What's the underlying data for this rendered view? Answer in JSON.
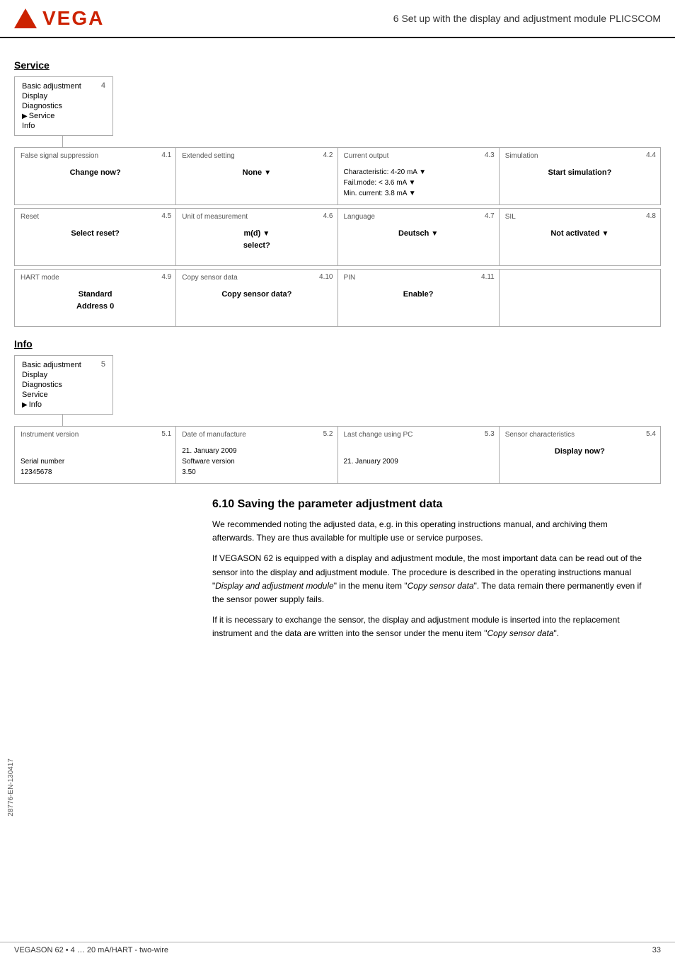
{
  "header": {
    "title": "6 Set up with the display and adjustment module PLICSCOM",
    "logo_text": "VEGA"
  },
  "service_section": {
    "heading": "Service",
    "menu": {
      "number": "4",
      "items": [
        "Basic adjustment",
        "Display",
        "Diagnostics",
        "Service",
        "Info"
      ],
      "active": "Service"
    },
    "row1": [
      {
        "id": "4.1",
        "title": "False signal suppression",
        "content": "Change now?",
        "bold": true
      },
      {
        "id": "4.2",
        "title": "Extended setting",
        "content": "None ▼",
        "bold": true
      },
      {
        "id": "4.3",
        "title": "Current output",
        "lines": [
          "Characteristic: 4-20 mA ▼",
          "Fail.mode: < 3.6 mA ▼",
          "Min. current: 3.8 mA ▼"
        ],
        "bold": false
      },
      {
        "id": "4.4",
        "title": "Simulation",
        "content": "Start simulation?",
        "bold": true
      }
    ],
    "row2": [
      {
        "id": "4.5",
        "title": "Reset",
        "content": "Select reset?",
        "bold": true
      },
      {
        "id": "4.6",
        "title": "Unit of measurement",
        "content": "m(d) ▼\nselect?",
        "bold": true
      },
      {
        "id": "4.7",
        "title": "Language",
        "content": "Deutsch ▼",
        "bold": true
      },
      {
        "id": "4.8",
        "title": "SIL",
        "content": "Not activated ▼",
        "bold": true
      }
    ],
    "row3": [
      {
        "id": "4.9",
        "title": "HART mode",
        "content": "Standard\nAddress 0",
        "bold": true
      },
      {
        "id": "4.10",
        "title": "Copy sensor data",
        "content": "Copy sensor data?",
        "bold": true
      },
      {
        "id": "4.11",
        "title": "PIN",
        "content": "Enable?",
        "bold": true
      }
    ]
  },
  "info_section": {
    "heading": "Info",
    "menu": {
      "number": "5",
      "items": [
        "Basic adjustment",
        "Display",
        "Diagnostics",
        "Service",
        "Info"
      ],
      "active": "Info"
    },
    "row1": [
      {
        "id": "5.1",
        "title": "Instrument version",
        "lines": [
          "",
          "Serial number",
          "12345678"
        ],
        "bold": false
      },
      {
        "id": "5.2",
        "title": "Date of manufacture",
        "lines": [
          "21. January 2009",
          "Software version",
          "3.50"
        ],
        "bold": false
      },
      {
        "id": "5.3",
        "title": "Last change using PC",
        "lines": [
          "",
          "21. January 2009"
        ],
        "bold": false
      },
      {
        "id": "5.4",
        "title": "Sensor characteristics",
        "content": "Display now?",
        "bold": true
      }
    ]
  },
  "saving_section": {
    "heading": "6.10  Saving the parameter adjustment data",
    "paragraphs": [
      "We recommended noting the adjusted data, e.g. in this operating instructions manual, and archiving them afterwards. They are thus available for multiple use or service purposes.",
      "If VEGASON 62 is equipped with a display and adjustment module, the most important data can be read out of the sensor into the display and adjustment module. The procedure is described in the operating instructions manual \"Display and adjustment module\" in the menu item \"Copy sensor data\". The data remain there permanently even if the sensor power supply fails.",
      "If it is necessary to exchange the sensor, the display and adjustment module is inserted into the replacement instrument and the data are written into the sensor under the menu item \"Copy sensor data\"."
    ]
  },
  "side_label": "28776-EN-130417",
  "footer": {
    "left": "VEGASON 62 • 4 … 20 mA/HART - two-wire",
    "right": "33"
  }
}
